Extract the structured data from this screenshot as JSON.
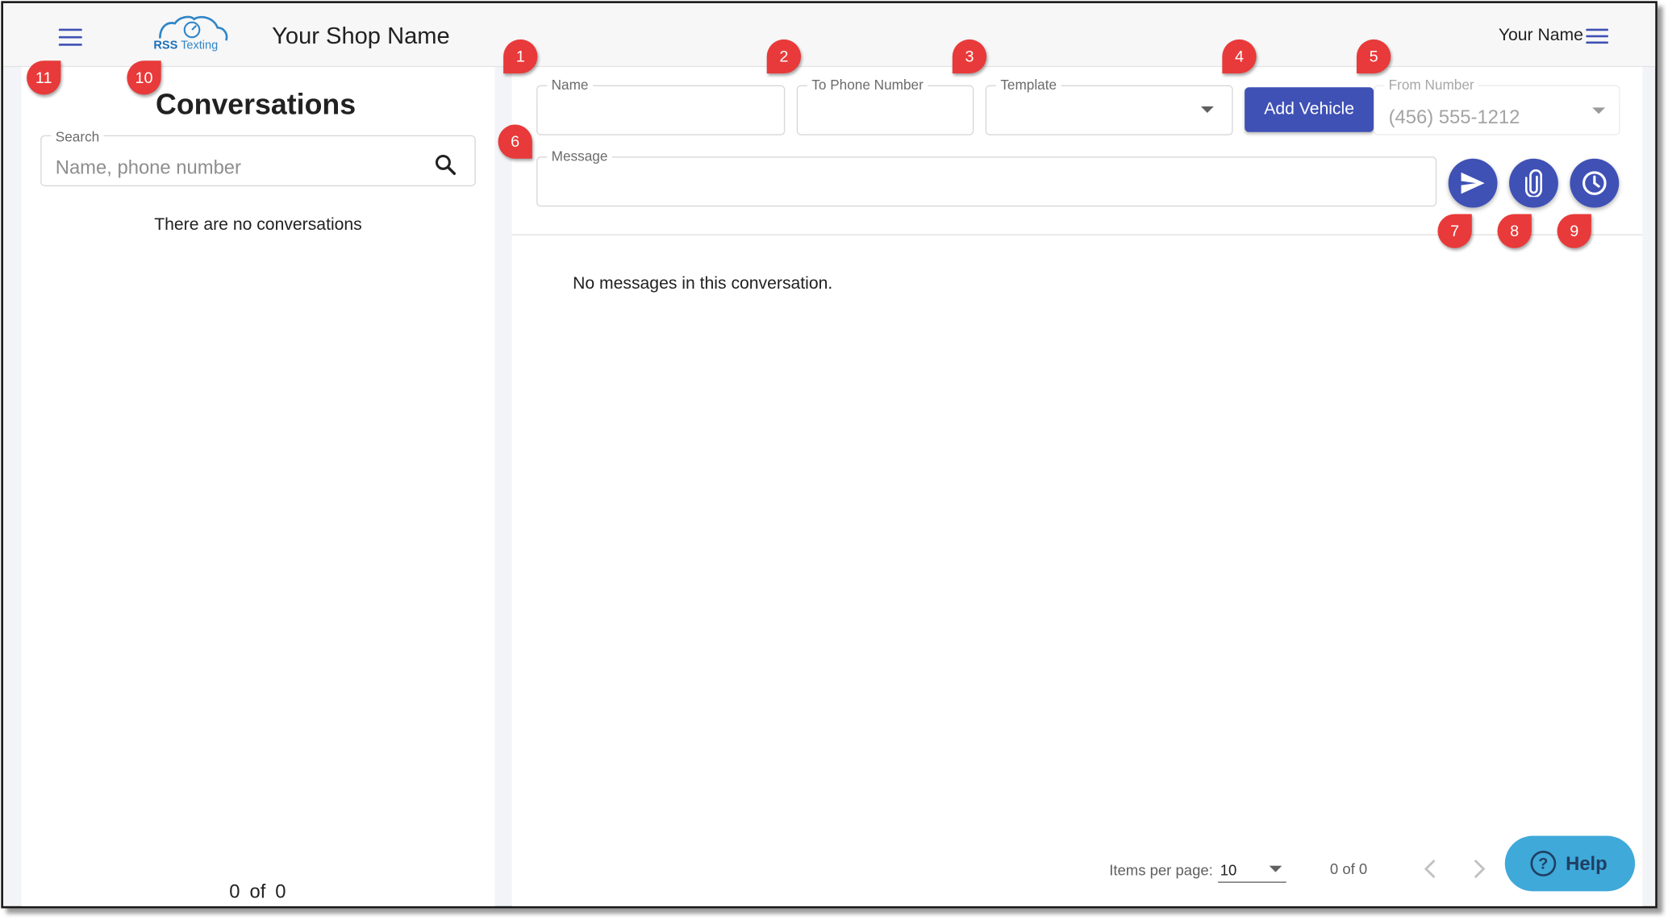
{
  "header": {
    "menu_icon": "menu-icon",
    "logo_text": "RSS Texting",
    "shop_name": "Your Shop Name",
    "user_name": "Your Name",
    "user_menu_icon": "menu-icon"
  },
  "sidebar": {
    "title": "Conversations",
    "search": {
      "label": "Search",
      "placeholder": "Name, phone number",
      "icon": "search-icon"
    },
    "empty_text": "There are no conversations",
    "pagination": {
      "current": "0",
      "separator": "of",
      "total": "0"
    }
  },
  "composer": {
    "name_label": "Name",
    "to_phone_label": "To Phone Number",
    "template_label": "Template",
    "add_vehicle_label": "Add Vehicle",
    "from_number_label": "From Number",
    "from_number_value": "(456) 555-1212",
    "message_label": "Message",
    "send_icon": "send-icon",
    "attach_icon": "paperclip-icon",
    "schedule_icon": "clock-icon"
  },
  "messages": {
    "empty_text": "No messages in this conversation."
  },
  "paginator": {
    "items_per_page_label": "Items per page:",
    "items_per_page_value": "10",
    "range_label": "0 of 0",
    "prev_icon": "chevron-left-icon",
    "next_icon": "chevron-right-icon"
  },
  "help": {
    "label": "Help",
    "icon": "question-icon"
  },
  "callouts": [
    "1",
    "2",
    "3",
    "4",
    "5",
    "6",
    "7",
    "8",
    "9",
    "10",
    "11"
  ],
  "colors": {
    "primary": "#3f51b5",
    "callout": "#e83a3a",
    "help": "#3fa9d9"
  }
}
